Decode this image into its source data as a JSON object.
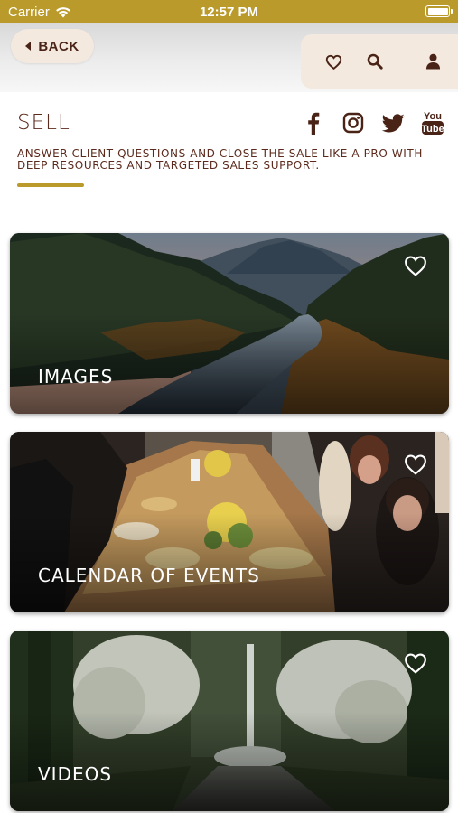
{
  "status_bar": {
    "carrier": "Carrier",
    "time": "12:57 PM"
  },
  "nav": {
    "back_label": "BACK",
    "actions": [
      {
        "icon": "heart-outline-icon"
      },
      {
        "icon": "search-icon"
      },
      {
        "icon": "user-icon"
      }
    ]
  },
  "header": {
    "title": "SELL",
    "tagline": "Answer client questions and close the sale like a pro with deep resources and targeted sales support.",
    "social": [
      "facebook-icon",
      "instagram-icon",
      "twitter-icon",
      "youtube-icon"
    ]
  },
  "cards": [
    {
      "label": "IMAGES",
      "favorite_icon": "heart-outline-icon"
    },
    {
      "label": "CALENDAR OF EVENTS",
      "favorite_icon": "heart-outline-icon"
    },
    {
      "label": "VIDEOS",
      "favorite_icon": "heart-outline-icon"
    }
  ],
  "colors": {
    "gold": "#b99a2b",
    "brown": "#5c2a1d",
    "cream": "#f3e9de"
  }
}
